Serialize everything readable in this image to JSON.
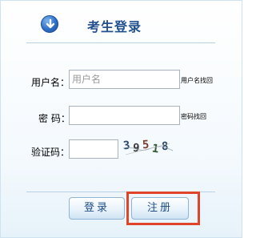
{
  "header": {
    "icon": "down-arrow-circle-icon",
    "title": "考生登录"
  },
  "form": {
    "username": {
      "label": "用户名：",
      "placeholder": "用户名",
      "value": "",
      "recover_link": "用户名找回"
    },
    "password": {
      "label": "密  码：",
      "value": "",
      "recover_link": "密码找回"
    },
    "captcha": {
      "label": "验证码：",
      "value": "",
      "image_text": "39518"
    }
  },
  "buttons": {
    "login": "登录",
    "register": "注册"
  },
  "colors": {
    "title": "#22508f",
    "highlight": "#e0452a",
    "button_text": "#1e4d8a"
  }
}
